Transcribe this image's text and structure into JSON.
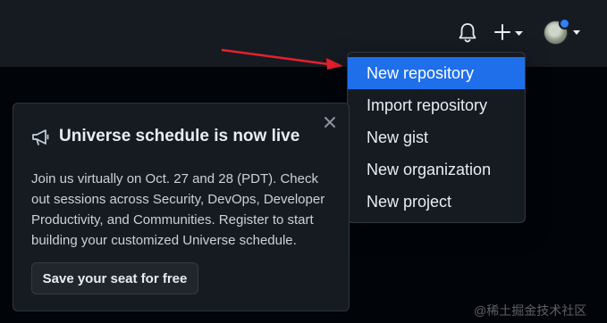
{
  "header": {
    "notifications_icon": "bell-icon",
    "create_icon": "plus-icon",
    "avatar_status_color": "#2f81f7"
  },
  "create_menu": {
    "items": [
      {
        "label": "New repository",
        "highlighted": true
      },
      {
        "label": "Import repository"
      },
      {
        "label": "New gist"
      },
      {
        "label": "New organization"
      },
      {
        "label": "New project"
      }
    ],
    "highlight_color": "#1f6feb"
  },
  "annotation": {
    "arrow_color": "#e5212b"
  },
  "promo_card": {
    "icon": "megaphone-icon",
    "title": "Universe schedule is now live",
    "body": "Join us virtually on Oct. 27 and 28 (PDT). Check out sessions across Security, DevOps, Developer Productivity, and Communities. Register to start building your customized Universe schedule.",
    "button_label": "Save your seat for free",
    "close_icon": "close-icon"
  },
  "watermark": "@稀土掘金技术社区",
  "colors": {
    "page_bg": "#010409",
    "header_bg": "#161b22",
    "card_bg": "#161b22",
    "border": "#30363d"
  }
}
